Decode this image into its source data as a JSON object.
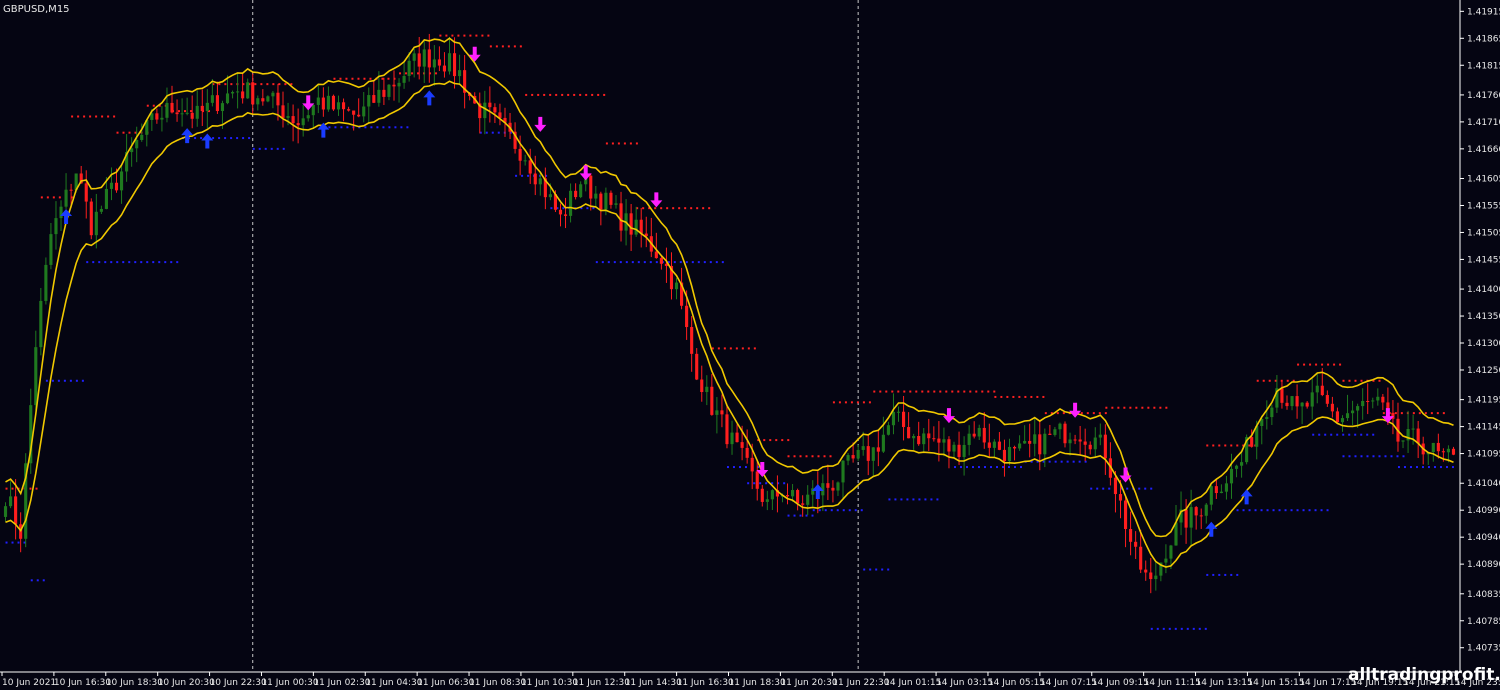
{
  "window": {
    "symbol_title": "GBPUSD,M15"
  },
  "watermark": "alltradingprofit.com",
  "colors": {
    "background": "#050512",
    "bull": "#1f7a1f",
    "bear": "#ff1e1e",
    "ma": "#f0c800",
    "resistance_dots": "#ff2020",
    "support_dots": "#2020ff",
    "buy_arrow": "#1a3cff",
    "sell_arrow": "#ff20ff",
    "axis": "#ffffff",
    "text": "#e8e8e8"
  },
  "chart_data": {
    "type": "candlestick",
    "symbol": "GBPUSD",
    "timeframe": "M15",
    "ylim": [
      1.4069,
      1.41936
    ],
    "y_ticks": [
      "1.41915",
      "1.41865",
      "1.41815",
      "1.41760",
      "1.41710",
      "1.41660",
      "1.41605",
      "1.41555",
      "1.41505",
      "1.41455",
      "1.41400",
      "1.41350",
      "1.41300",
      "1.41250",
      "1.41195",
      "1.41145",
      "1.41095",
      "1.41040",
      "1.40990",
      "1.40940",
      "1.40890",
      "1.40835",
      "1.40785",
      "1.40735"
    ],
    "x_ticks": [
      "10 Jun 2021",
      "10 Jun 16:30",
      "10 Jun 18:30",
      "10 Jun 20:30",
      "10 Jun 22:30",
      "11 Jun 00:30",
      "11 Jun 02:30",
      "11 Jun 04:30",
      "11 Jun 06:30",
      "11 Jun 08:30",
      "11 Jun 10:30",
      "11 Jun 12:30",
      "11 Jun 14:30",
      "11 Jun 16:30",
      "11 Jun 18:30",
      "11 Jun 20:30",
      "11 Jun 22:30",
      "14 Jun 01:15",
      "14 Jun 03:15",
      "14 Jun 05:15",
      "14 Jun 07:15",
      "14 Jun 09:15",
      "14 Jun 11:15",
      "14 Jun 13:15",
      "14 Jun 15:15",
      "14 Jun 17:15",
      "14 Jun 19:15",
      "14 Jun 21:15",
      "14 Jun 23:1"
    ],
    "price_anchors": [
      [
        0,
        1.4102
      ],
      [
        3,
        1.4095
      ],
      [
        6,
        1.413
      ],
      [
        9,
        1.415
      ],
      [
        12,
        1.4157
      ],
      [
        14,
        1.4162
      ],
      [
        17,
        1.4152
      ],
      [
        19,
        1.4155
      ],
      [
        22,
        1.416
      ],
      [
        26,
        1.4167
      ],
      [
        30,
        1.4172
      ],
      [
        34,
        1.4174
      ],
      [
        38,
        1.4172
      ],
      [
        42,
        1.4175
      ],
      [
        46,
        1.4177
      ],
      [
        50,
        1.4176
      ],
      [
        54,
        1.4174
      ],
      [
        58,
        1.4171
      ],
      [
        62,
        1.4175
      ],
      [
        66,
        1.4173
      ],
      [
        70,
        1.4172
      ],
      [
        74,
        1.4176
      ],
      [
        78,
        1.4179
      ],
      [
        82,
        1.4183
      ],
      [
        86,
        1.4183
      ],
      [
        90,
        1.418
      ],
      [
        93,
        1.4174
      ],
      [
        96,
        1.4172
      ],
      [
        100,
        1.4168
      ],
      [
        103,
        1.4165
      ],
      [
        106,
        1.416
      ],
      [
        110,
        1.4153
      ],
      [
        114,
        1.416
      ],
      [
        118,
        1.4157
      ],
      [
        122,
        1.4153
      ],
      [
        126,
        1.415
      ],
      [
        130,
        1.4146
      ],
      [
        133,
        1.414
      ],
      [
        136,
        1.4128
      ],
      [
        139,
        1.412
      ],
      [
        142,
        1.4115
      ],
      [
        145,
        1.411
      ],
      [
        148,
        1.4105
      ],
      [
        151,
        1.41
      ],
      [
        154,
        1.4103
      ],
      [
        157,
        1.41
      ],
      [
        160,
        1.4102
      ],
      [
        164,
        1.4104
      ],
      [
        168,
        1.4108
      ],
      [
        172,
        1.411
      ],
      [
        176,
        1.4116
      ],
      [
        180,
        1.4113
      ],
      [
        184,
        1.4112
      ],
      [
        188,
        1.411
      ],
      [
        192,
        1.4114
      ],
      [
        196,
        1.4111
      ],
      [
        200,
        1.4109
      ],
      [
        204,
        1.4111
      ],
      [
        208,
        1.4113
      ],
      [
        212,
        1.4114
      ],
      [
        216,
        1.4112
      ],
      [
        218,
        1.411
      ],
      [
        221,
        1.41
      ],
      [
        224,
        1.409
      ],
      [
        227,
        1.4085
      ],
      [
        230,
        1.4092
      ],
      [
        233,
        1.4097
      ],
      [
        236,
        1.4098
      ],
      [
        239,
        1.4103
      ],
      [
        242,
        1.4105
      ],
      [
        245,
        1.4108
      ],
      [
        248,
        1.4115
      ],
      [
        252,
        1.4122
      ],
      [
        256,
        1.4117
      ],
      [
        260,
        1.412
      ],
      [
        264,
        1.4116
      ],
      [
        268,
        1.4118
      ],
      [
        272,
        1.4119
      ],
      [
        276,
        1.4112
      ],
      [
        280,
        1.4112
      ],
      [
        284,
        1.4109
      ],
      [
        287,
        1.4108
      ]
    ],
    "candle_count": 288,
    "series": [
      {
        "name": "MA fast",
        "kind": "moving_average"
      },
      {
        "name": "MA slow",
        "kind": "moving_average"
      }
    ],
    "buy_signals": [
      {
        "i": 12,
        "price": 1.4153
      },
      {
        "i": 36,
        "price": 1.4168
      },
      {
        "i": 40,
        "price": 1.4167
      },
      {
        "i": 63,
        "price": 1.4169
      },
      {
        "i": 84,
        "price": 1.4175
      },
      {
        "i": 161,
        "price": 1.4102
      },
      {
        "i": 239,
        "price": 1.4095
      },
      {
        "i": 246,
        "price": 1.4101
      }
    ],
    "sell_signals": [
      {
        "i": 60,
        "price": 1.4175
      },
      {
        "i": 93,
        "price": 1.4184
      },
      {
        "i": 106,
        "price": 1.4171
      },
      {
        "i": 115,
        "price": 1.4162
      },
      {
        "i": 129,
        "price": 1.4157
      },
      {
        "i": 150,
        "price": 1.4107
      },
      {
        "i": 187,
        "price": 1.4117
      },
      {
        "i": 212,
        "price": 1.4118
      },
      {
        "i": 222,
        "price": 1.4106
      },
      {
        "i": 274,
        "price": 1.4117
      }
    ],
    "resistance_levels": [
      {
        "from": 0,
        "to": 6,
        "price": 1.4103
      },
      {
        "from": 7,
        "to": 13,
        "price": 1.4157
      },
      {
        "from": 13,
        "to": 22,
        "price": 1.4172
      },
      {
        "from": 22,
        "to": 28,
        "price": 1.4169
      },
      {
        "from": 28,
        "to": 33,
        "price": 1.4174
      },
      {
        "from": 33,
        "to": 41,
        "price": 1.4173
      },
      {
        "from": 41,
        "to": 57,
        "price": 1.4178
      },
      {
        "from": 65,
        "to": 78,
        "price": 1.4179
      },
      {
        "from": 78,
        "to": 86,
        "price": 1.418
      },
      {
        "from": 86,
        "to": 96,
        "price": 1.4187
      },
      {
        "from": 96,
        "to": 103,
        "price": 1.4185
      },
      {
        "from": 103,
        "to": 119,
        "price": 1.4176
      },
      {
        "from": 119,
        "to": 125,
        "price": 1.4167
      },
      {
        "from": 125,
        "to": 140,
        "price": 1.4155
      },
      {
        "from": 140,
        "to": 149,
        "price": 1.4129
      },
      {
        "from": 149,
        "to": 155,
        "price": 1.4112
      },
      {
        "from": 155,
        "to": 164,
        "price": 1.4109
      },
      {
        "from": 164,
        "to": 172,
        "price": 1.4119
      },
      {
        "from": 172,
        "to": 196,
        "price": 1.4121
      },
      {
        "from": 196,
        "to": 206,
        "price": 1.412
      },
      {
        "from": 206,
        "to": 218,
        "price": 1.4117
      },
      {
        "from": 218,
        "to": 231,
        "price": 1.4118
      },
      {
        "from": 238,
        "to": 248,
        "price": 1.4111
      },
      {
        "from": 248,
        "to": 256,
        "price": 1.4123
      },
      {
        "from": 256,
        "to": 265,
        "price": 1.4126
      },
      {
        "from": 265,
        "to": 273,
        "price": 1.4123
      },
      {
        "from": 273,
        "to": 285,
        "price": 1.4117
      }
    ],
    "support_levels": [
      {
        "from": 0,
        "to": 4,
        "price": 1.4093
      },
      {
        "from": 5,
        "to": 8,
        "price": 1.4086
      },
      {
        "from": 8,
        "to": 16,
        "price": 1.4123
      },
      {
        "from": 16,
        "to": 35,
        "price": 1.4145
      },
      {
        "from": 35,
        "to": 49,
        "price": 1.4168
      },
      {
        "from": 49,
        "to": 56,
        "price": 1.4166
      },
      {
        "from": 64,
        "to": 80,
        "price": 1.417
      },
      {
        "from": 94,
        "to": 101,
        "price": 1.4169
      },
      {
        "from": 101,
        "to": 108,
        "price": 1.4161
      },
      {
        "from": 108,
        "to": 117,
        "price": 1.4155
      },
      {
        "from": 117,
        "to": 143,
        "price": 1.4145
      },
      {
        "from": 143,
        "to": 150,
        "price": 1.4107
      },
      {
        "from": 147,
        "to": 155,
        "price": 1.4104
      },
      {
        "from": 155,
        "to": 160,
        "price": 1.4098
      },
      {
        "from": 160,
        "to": 170,
        "price": 1.4099
      },
      {
        "from": 170,
        "to": 175,
        "price": 1.4088
      },
      {
        "from": 175,
        "to": 185,
        "price": 1.4101
      },
      {
        "from": 188,
        "to": 202,
        "price": 1.4107
      },
      {
        "from": 202,
        "to": 215,
        "price": 1.4108
      },
      {
        "from": 215,
        "to": 227,
        "price": 1.4103
      },
      {
        "from": 227,
        "to": 238,
        "price": 1.4077
      },
      {
        "from": 238,
        "to": 244,
        "price": 1.4087
      },
      {
        "from": 244,
        "to": 262,
        "price": 1.4099
      },
      {
        "from": 259,
        "to": 272,
        "price": 1.4113
      },
      {
        "from": 265,
        "to": 277,
        "price": 1.4109
      },
      {
        "from": 276,
        "to": 287,
        "price": 1.4107
      }
    ],
    "separators": [
      49,
      169
    ],
    "grid": false
  }
}
